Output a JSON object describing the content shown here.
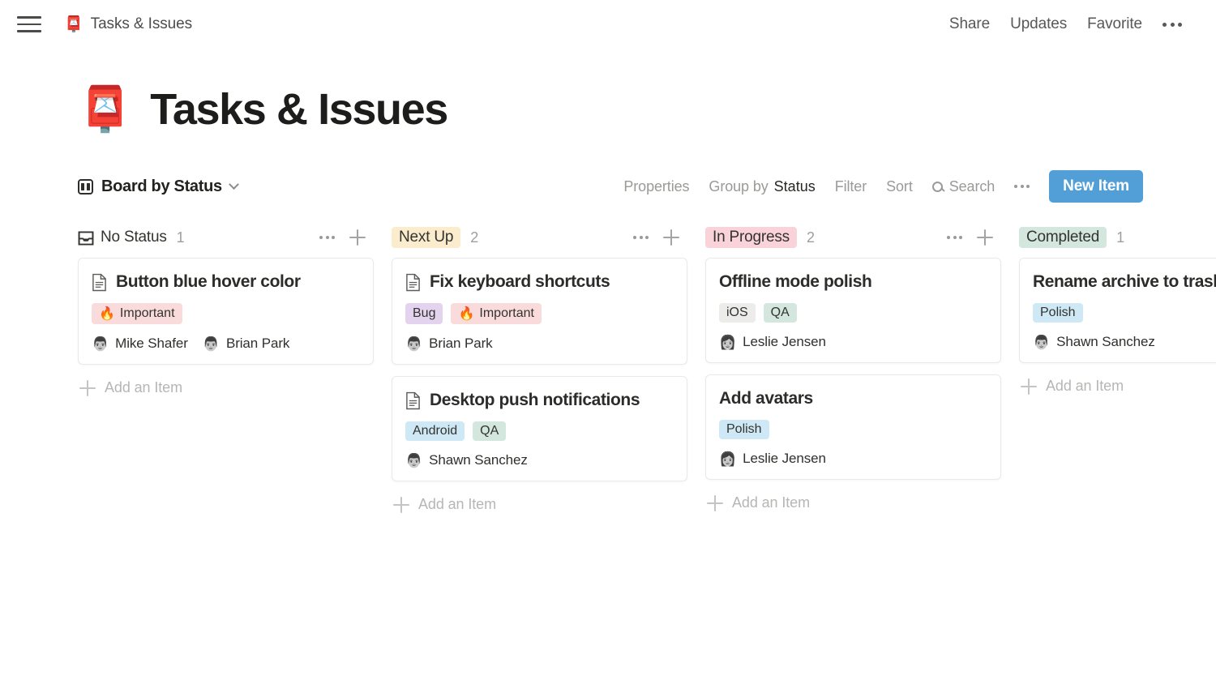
{
  "topbar": {
    "menu_icon": "hamburger-menu-icon",
    "doc_emoji": "📮",
    "doc_title": "Tasks & Issues",
    "links": [
      "Share",
      "Updates",
      "Favorite"
    ],
    "more_icon": "ellipsis-icon"
  },
  "page": {
    "emoji": "📮",
    "title": "Tasks & Issues"
  },
  "toolbar": {
    "view_icon": "board-view-icon",
    "view_name": "Board by Status",
    "chevron_icon": "chevron-down-icon",
    "properties": "Properties",
    "group_by_label": "Group by",
    "group_by_value": "Status",
    "filter": "Filter",
    "sort": "Sort",
    "search_icon": "search-icon",
    "search": "Search",
    "more_icon": "ellipsis-icon",
    "new_item": "New Item",
    "new_item_color": "#529fd8"
  },
  "board": {
    "add_item_label": "Add an Item",
    "columns": [
      {
        "name": "No Status",
        "count": "1",
        "chip": false,
        "chip_bg": "transparent",
        "icon": "inbox-tray-icon",
        "cards": [
          {
            "title": "Button blue hover color",
            "has_doc_icon": true,
            "tags": [
              {
                "label": "Important",
                "emoji": "🔥",
                "bg": "#fadbdb"
              }
            ],
            "people": [
              {
                "name": "Mike Shafer",
                "avatar": "👨",
                "color": false
              },
              {
                "name": "Brian Park",
                "avatar": "👨",
                "color": false
              }
            ]
          }
        ]
      },
      {
        "name": "Next Up",
        "count": "2",
        "chip": true,
        "chip_bg": "#fcecce",
        "icon": null,
        "cards": [
          {
            "title": "Fix keyboard shortcuts",
            "has_doc_icon": true,
            "tags": [
              {
                "label": "Bug",
                "emoji": "",
                "bg": "#e4d3ee"
              },
              {
                "label": "Important",
                "emoji": "🔥",
                "bg": "#fadbdb"
              }
            ],
            "people": [
              {
                "name": "Brian Park",
                "avatar": "👨",
                "color": false
              }
            ]
          },
          {
            "title": "Desktop push notifications",
            "has_doc_icon": true,
            "tags": [
              {
                "label": "Android",
                "emoji": "",
                "bg": "#cfe8f5"
              },
              {
                "label": "QA",
                "emoji": "",
                "bg": "#d3e7de"
              }
            ],
            "people": [
              {
                "name": "Shawn Sanchez",
                "avatar": "👨",
                "color": false
              }
            ]
          }
        ]
      },
      {
        "name": "In Progress",
        "count": "2",
        "chip": true,
        "chip_bg": "#f9d3d9",
        "icon": null,
        "cards": [
          {
            "title": "Offline mode polish",
            "has_doc_icon": false,
            "tags": [
              {
                "label": "iOS",
                "emoji": "",
                "bg": "#ececeb"
              },
              {
                "label": "QA",
                "emoji": "",
                "bg": "#d3e7de"
              }
            ],
            "people": [
              {
                "name": "Leslie Jensen",
                "avatar": "👩",
                "color": false
              }
            ]
          },
          {
            "title": "Add avatars",
            "has_doc_icon": false,
            "tags": [
              {
                "label": "Polish",
                "emoji": "",
                "bg": "#cfe8f5"
              }
            ],
            "people": [
              {
                "name": "Leslie Jensen",
                "avatar": "👩",
                "color": false
              }
            ]
          }
        ]
      },
      {
        "name": "Completed",
        "count": "1",
        "chip": true,
        "chip_bg": "#d3e7de",
        "icon": null,
        "cards": [
          {
            "title": "Rename archive to trash",
            "has_doc_icon": false,
            "tags": [
              {
                "label": "Polish",
                "emoji": "",
                "bg": "#cfe8f5"
              }
            ],
            "people": [
              {
                "name": "Shawn Sanchez",
                "avatar": "👨",
                "color": false
              }
            ]
          }
        ]
      }
    ]
  }
}
